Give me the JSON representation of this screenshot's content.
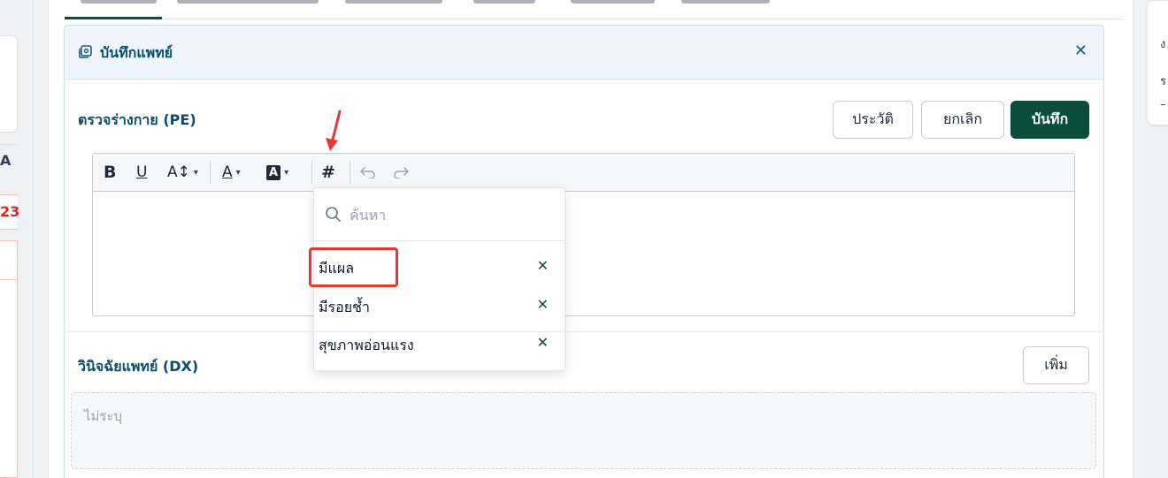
{
  "left_panel": {
    "letter": "A",
    "red_number": "23"
  },
  "note_card": {
    "title": "บันทึกแพทย์",
    "close_icon": "close-icon"
  },
  "pe_section": {
    "label": "ตรวจร่างกาย (PE)",
    "buttons": {
      "history": "ประวัติ",
      "cancel": "ยกเลิก",
      "save": "บันทึก"
    }
  },
  "toolbar": {
    "bold": "B",
    "underline": "U",
    "font_size": "A↕",
    "font_color": "A",
    "highlight": "A",
    "hashtag": "#",
    "icons": [
      "bold-icon",
      "underline-icon",
      "font-size-icon",
      "font-color-icon",
      "highlight-icon",
      "hashtag-icon",
      "undo-icon",
      "redo-icon"
    ]
  },
  "tag_dropdown": {
    "search_placeholder": "ค้นหา",
    "items": [
      {
        "label": "มีแผล",
        "remove": "✕"
      },
      {
        "label": "มีรอยช้ำ",
        "remove": "✕"
      },
      {
        "label": "สุขภาพอ่อนแรง",
        "remove": "✕"
      }
    ]
  },
  "dx_section": {
    "label": "วินิจฉัยแพทย์ (DX)",
    "add_button": "เพิ่ม",
    "empty_text": "ไม่ระบุ"
  },
  "colors": {
    "primary": "#0b4d3c",
    "heading": "#0b4d6e",
    "annotation": "#e53935"
  }
}
